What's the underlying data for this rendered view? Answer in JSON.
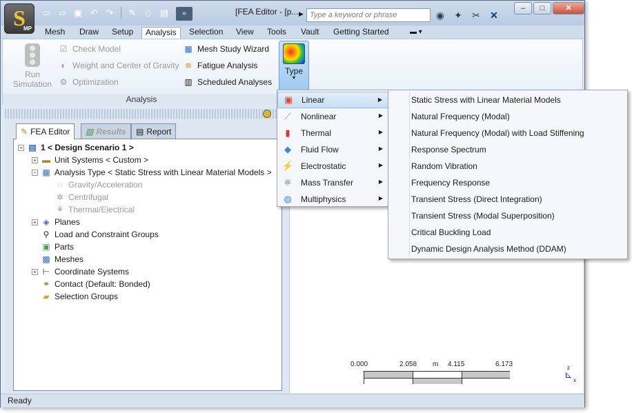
{
  "window": {
    "title": "[FEA Editor - [p...",
    "app_logo": "S",
    "app_badge": "MP"
  },
  "quick_access": [
    "new-icon",
    "open-icon",
    "save-icon",
    "undo-icon",
    "redo-icon",
    "edit-icon",
    "eraser-icon",
    "properties-icon"
  ],
  "search": {
    "placeholder": "Type a keyword or phrase"
  },
  "menu_tabs": [
    "Mesh",
    "Draw",
    "Setup",
    "Analysis",
    "Selection",
    "View",
    "Tools",
    "Vault",
    "Getting Started"
  ],
  "active_tab": "Analysis",
  "ribbon": {
    "run_simulation": "Run\nSimulation",
    "check_model": "Check Model",
    "weight_center": "Weight and Center of Gravity",
    "optimization": "Optimization",
    "mesh_study_wizard": "Mesh Study Wizard",
    "fatigue_analysis": "Fatigue Analysis",
    "scheduled_analyses": "Scheduled Analyses",
    "group_label": "Analysis",
    "type_label": "Type"
  },
  "panel_tabs": {
    "fea_editor": "FEA Editor",
    "results": "Results",
    "report": "Report"
  },
  "tree": [
    {
      "label": "1 < Design Scenario 1 >",
      "indent": 0,
      "expander": "−",
      "icon": "doc",
      "bold": true
    },
    {
      "label": "Unit Systems < Custom >",
      "indent": 1,
      "expander": "+",
      "icon": "ruler"
    },
    {
      "label": "Analysis Type < Static Stress with Linear Material Models >",
      "indent": 1,
      "expander": "−",
      "icon": "table"
    },
    {
      "label": "Gravity/Acceleration",
      "indent": 2,
      "expander": "",
      "icon": "gravity",
      "disabled": true
    },
    {
      "label": "Centrifugal",
      "indent": 2,
      "expander": "",
      "icon": "spin",
      "disabled": true
    },
    {
      "label": "Thermal/Electrical",
      "indent": 2,
      "expander": "",
      "icon": "thermal",
      "disabled": true
    },
    {
      "label": "Planes",
      "indent": 1,
      "expander": "+",
      "icon": "planes"
    },
    {
      "label": "Load and Constraint Groups",
      "indent": 1,
      "expander": "",
      "icon": "load"
    },
    {
      "label": "Parts",
      "indent": 1,
      "expander": "",
      "icon": "parts"
    },
    {
      "label": "Meshes",
      "indent": 1,
      "expander": "",
      "icon": "mesh"
    },
    {
      "label": "Coordinate Systems",
      "indent": 1,
      "expander": "+",
      "icon": "coords"
    },
    {
      "label": "Contact (Default: Bonded)",
      "indent": 1,
      "expander": "",
      "icon": "contact"
    },
    {
      "label": "Selection Groups",
      "indent": 1,
      "expander": "",
      "icon": "folder"
    }
  ],
  "type_menu": [
    {
      "label": "Linear",
      "icon": "linear-icon",
      "highlighted": true
    },
    {
      "label": "Nonlinear",
      "icon": "nonlinear-icon"
    },
    {
      "label": "Thermal",
      "icon": "thermometer-icon"
    },
    {
      "label": "Fluid Flow",
      "icon": "droplet-icon"
    },
    {
      "label": "Electrostatic",
      "icon": "lightning-icon"
    },
    {
      "label": "Mass Transfer",
      "icon": "mass-transfer-icon"
    },
    {
      "label": "Multiphysics",
      "icon": "multiphysics-icon"
    }
  ],
  "linear_submenu": [
    "Static Stress with Linear Material Models",
    "Natural Frequency (Modal)",
    "Natural Frequency (Modal) with Load Stiffening",
    "Response Spectrum",
    "Random Vibration",
    "Frequency Response",
    "Transient Stress (Direct Integration)",
    "Transient Stress (Modal Superposition)",
    "Critical Buckling Load",
    "Dynamic Design Analysis Method (DDAM)"
  ],
  "scale": {
    "ticks": [
      "0.000",
      "2.058",
      "4.115",
      "6.173"
    ],
    "unit": "m"
  },
  "axis_labels": {
    "z": "z",
    "x": "x"
  },
  "status": "Ready"
}
